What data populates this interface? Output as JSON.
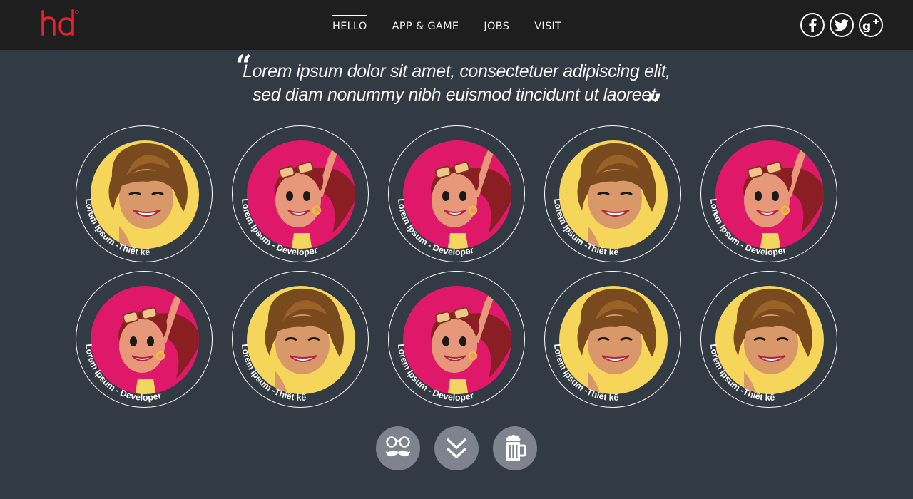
{
  "header": {
    "logo_text": "hd",
    "nav": [
      {
        "label": "HELLO",
        "active": true
      },
      {
        "label": "APP & GAME",
        "active": false
      },
      {
        "label": "JOBS",
        "active": false
      },
      {
        "label": "VISIT",
        "active": false
      }
    ],
    "social": [
      {
        "icon": "facebook-icon"
      },
      {
        "icon": "twitter-icon"
      },
      {
        "icon": "google-plus-icon"
      }
    ]
  },
  "quote": {
    "open_mark": "“",
    "line1": "Lorem ipsum dolor sit amet, consectetuer adipiscing elit,",
    "line2": "sed diam nonummy nibh euismod tincidunt ut laoreet.",
    "close_mark": "„"
  },
  "profiles": [
    {
      "caption": "Lorem Ipsum -Thiết kế",
      "avatar": "short-hair-woman-yellow",
      "bg": "#f5d55a"
    },
    {
      "caption": "Lorem Ipsum - Developer",
      "avatar": "sunglasses-woman-pink",
      "bg": "#e0186a"
    },
    {
      "caption": "Lorem Ipsum - Developer",
      "avatar": "sunglasses-woman-pink",
      "bg": "#e0186a"
    },
    {
      "caption": "Lorem Ipsum -Thiết kế",
      "avatar": "short-hair-woman-yellow",
      "bg": "#f5d55a"
    },
    {
      "caption": "Lorem Ipsum - Developer",
      "avatar": "sunglasses-woman-pink",
      "bg": "#e0186a"
    },
    {
      "caption": "Lorem Ipsum - Developer",
      "avatar": "sunglasses-woman-pink",
      "bg": "#e0186a"
    },
    {
      "caption": "Lorem Ipsum -Thiết kế",
      "avatar": "short-hair-woman-yellow",
      "bg": "#f5d55a"
    },
    {
      "caption": "Lorem Ipsum - Developer",
      "avatar": "sunglasses-woman-pink",
      "bg": "#e0186a"
    },
    {
      "caption": "Lorem Ipsum -Thiết kế",
      "avatar": "short-hair-woman-yellow",
      "bg": "#f5d55a"
    },
    {
      "caption": "Lorem Ipsum -Thiết kế",
      "avatar": "short-hair-woman-yellow",
      "bg": "#f5d55a"
    }
  ],
  "actions": [
    {
      "icon": "glasses-mustache-icon"
    },
    {
      "icon": "double-chevron-down-icon"
    },
    {
      "icon": "beer-mug-icon"
    }
  ],
  "colors": {
    "page_bg": "#323a44",
    "header_bg": "#1e1e1e",
    "logo_red": "#e52330",
    "action_bg": "#7d848d"
  }
}
